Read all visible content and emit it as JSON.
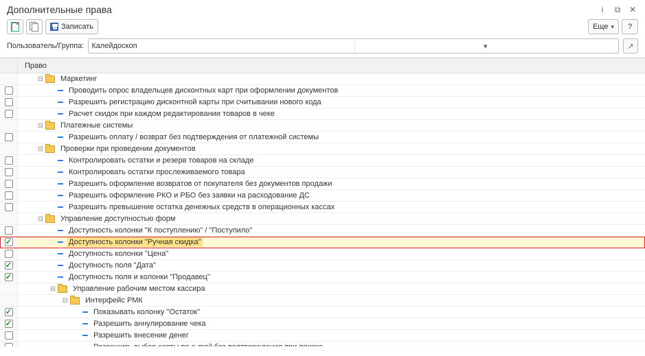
{
  "window": {
    "title": "Дополнительные права",
    "btn_save": "Записать",
    "btn_more": "Еще",
    "user_label": "Пользователь/Группа:",
    "user_value": "Калейдоскоп"
  },
  "grid": {
    "header": "Право"
  },
  "rows": [
    {
      "type": "folder",
      "indent": 1,
      "toggle": "-",
      "label": "Маркетинг",
      "check": null
    },
    {
      "type": "item",
      "indent": 2,
      "label": "Проводить опрос владельцев дисконтных карт при оформлении документов",
      "check": false
    },
    {
      "type": "item",
      "indent": 2,
      "label": "Разрешить регистрацию дисконтной карты при считывании нового кода",
      "check": false
    },
    {
      "type": "item",
      "indent": 2,
      "label": "Расчет скидок при каждом редактировании товаров в чеке",
      "check": false
    },
    {
      "type": "folder",
      "indent": 1,
      "toggle": "-",
      "label": "Платежные системы",
      "check": null
    },
    {
      "type": "item",
      "indent": 2,
      "label": "Разрешить оплату / возврат без подтверждения от платежной системы",
      "check": false
    },
    {
      "type": "folder",
      "indent": 1,
      "toggle": "-",
      "label": "Проверки при проведении документов",
      "check": null
    },
    {
      "type": "item",
      "indent": 2,
      "label": "Контролировать остатки и резерв товаров на складе",
      "check": false
    },
    {
      "type": "item",
      "indent": 2,
      "label": "Контролировать остатки прослеживаемого товара",
      "check": false
    },
    {
      "type": "item",
      "indent": 2,
      "label": "Разрешить оформление возвратов от покупателя без документов продажи",
      "check": false
    },
    {
      "type": "item",
      "indent": 2,
      "label": "Разрешить оформление РКО и РБО без заявки на расходование ДС",
      "check": false
    },
    {
      "type": "item",
      "indent": 2,
      "label": "Разрешить превышение остатка денежных средств в операционных кассах",
      "check": false
    },
    {
      "type": "folder",
      "indent": 1,
      "toggle": "-",
      "label": "Управление доступностью форм",
      "check": null
    },
    {
      "type": "item",
      "indent": 2,
      "label": "Доступность колонки \"К поступлению\" / \"Поступило\"",
      "check": false
    },
    {
      "type": "item",
      "indent": 2,
      "label": "Доступность колонки \"Ручная скидка\"",
      "check": true,
      "selected": true
    },
    {
      "type": "item",
      "indent": 2,
      "label": "Доступность колонки \"Цена\"",
      "check": false
    },
    {
      "type": "item",
      "indent": 2,
      "label": "Доступность поля \"Дата\"",
      "check": true
    },
    {
      "type": "item",
      "indent": 2,
      "label": "Доступность поля и колонки \"Продавец\"",
      "check": true
    },
    {
      "type": "folder",
      "indent": 2,
      "toggle": "-",
      "label": "Управление рабочим местом кассира",
      "check": null
    },
    {
      "type": "folder",
      "indent": 3,
      "toggle": "-",
      "label": "Интерфейс РМК",
      "check": null
    },
    {
      "type": "item",
      "indent": 4,
      "label": "Показывать колонку \"Остаток\"",
      "check": true
    },
    {
      "type": "item",
      "indent": 4,
      "label": "Разрешить аннулирование чека",
      "check": true
    },
    {
      "type": "item",
      "indent": 4,
      "label": "Разрешить внесение денег",
      "check": false
    },
    {
      "type": "item",
      "indent": 4,
      "label": "Разрешить выбор карты по e-mail без подтверждения при поиске",
      "check": false
    }
  ]
}
